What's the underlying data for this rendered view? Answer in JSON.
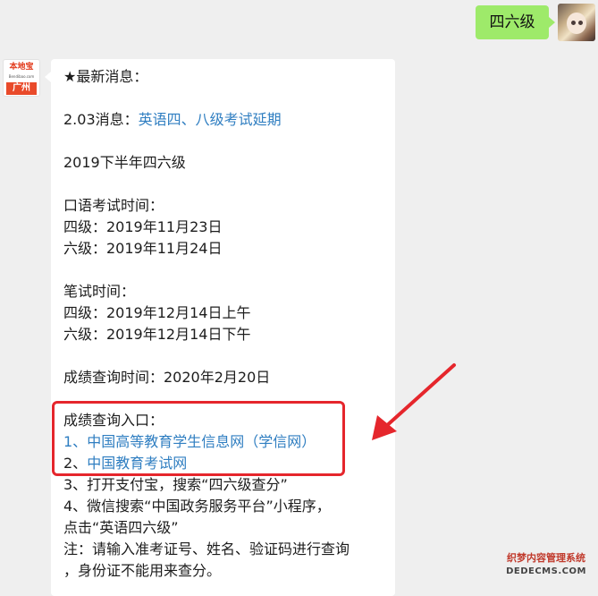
{
  "user": {
    "message": "四六级"
  },
  "bot": {
    "logo_text": "本地宝",
    "logo_url": "Bendibao.com",
    "city": "广州"
  },
  "message": {
    "latest_title": "★最新消息：",
    "notice_prefix": "2.03消息：",
    "notice_link": "英语四、八级考试延期",
    "exam_title": "2019下半年四六级",
    "oral_title": "口语考试时间：",
    "oral_cet4": "四级：2019年11月23日",
    "oral_cet6": "六级：2019年11月24日",
    "written_title": "笔试时间：",
    "written_cet4": "四级：2019年12月14日上午",
    "written_cet6": "六级：2019年12月14日下午",
    "score_time": "成绩查询时间：2020年2月20日",
    "entry_title": "成绩查询入口：",
    "entry1_prefix": "1、",
    "entry1_link": "中国高等教育学生信息网（学信网）",
    "entry2_prefix": "2、",
    "entry2_link": "中国教育考试网",
    "entry3": "3、打开支付宝，搜索“四六级查分”",
    "entry4_line1": "4、微信搜索“中国政务服务平台”小程序，",
    "entry4_line2": "点击“英语四六级”",
    "note_line1": "注：请输入准考证号、姓名、验证码进行查询",
    "note_line2": "，身份证不能用来查分。"
  },
  "watermark": {
    "top": "织梦内容管理系统",
    "bottom": "DEDECMS.COM"
  },
  "colors": {
    "link": "#2f7ec1",
    "user_bubble": "#9eea6a",
    "highlight": "#e5262c"
  }
}
